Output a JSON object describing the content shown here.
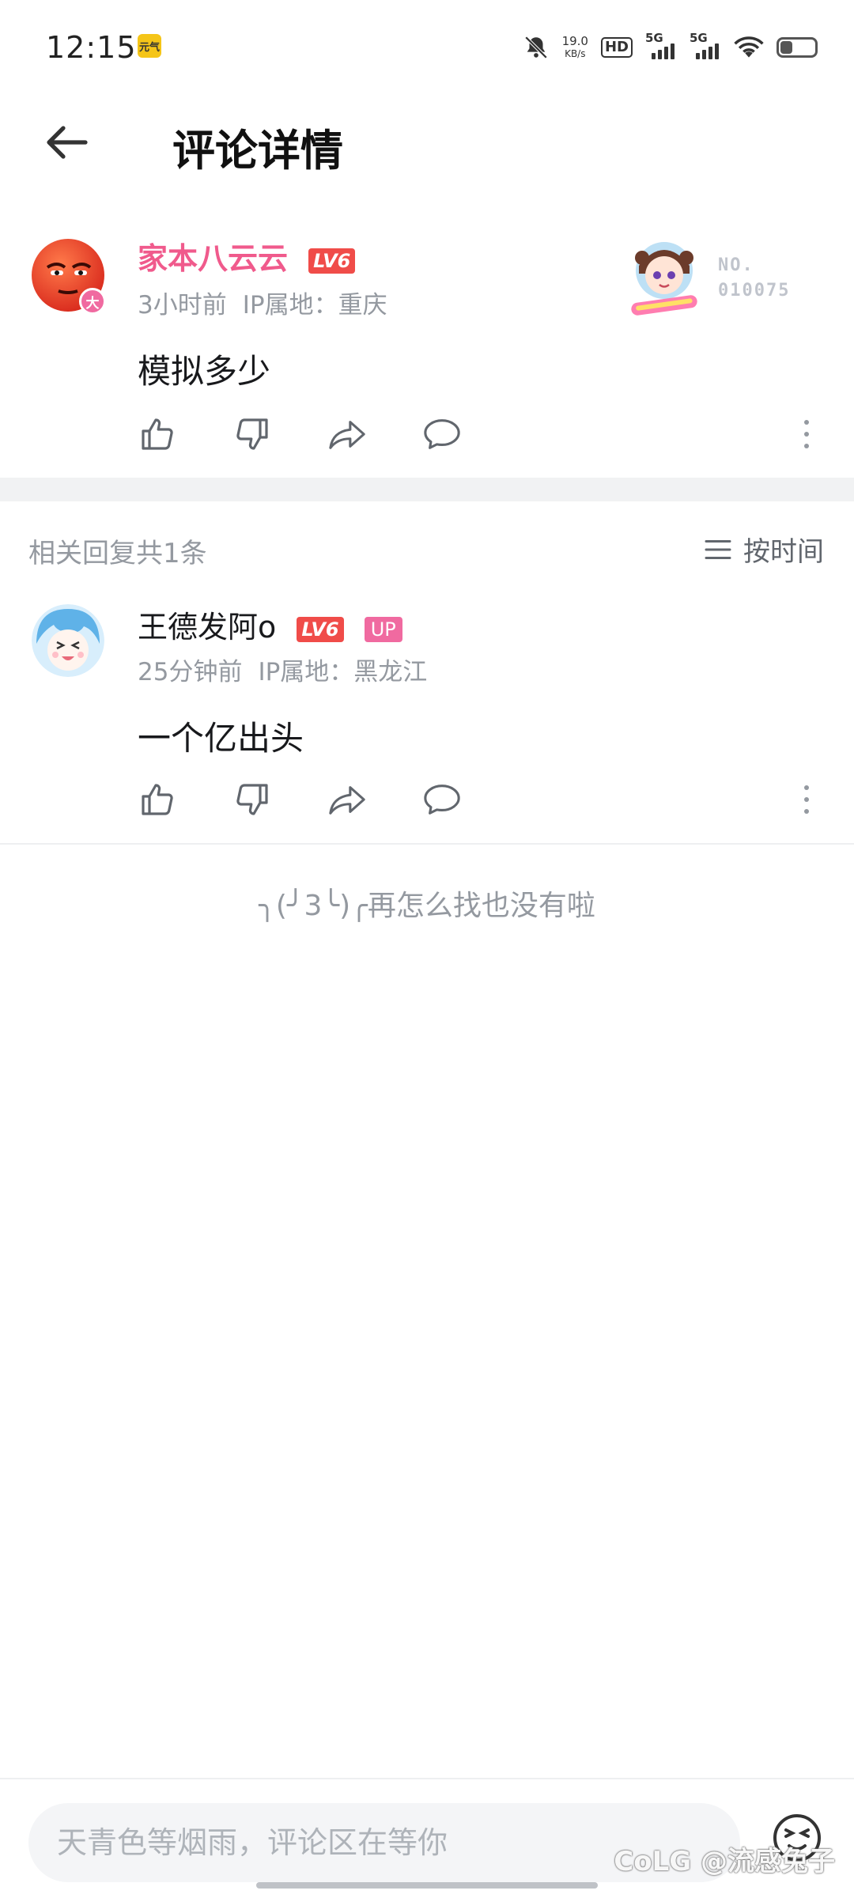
{
  "status_bar": {
    "time": "12:15",
    "app_badge": "元气",
    "net_speed_value": "19.0",
    "net_speed_unit": "KB/s",
    "hd_label": "HD",
    "sim1_label": "5G",
    "sim2_label": "5G",
    "battery_level": 0.35
  },
  "header": {
    "title": "评论详情"
  },
  "root_comment": {
    "username": "家本八云云",
    "username_color": "#f05a8c",
    "level": "LV6",
    "badge_char": "大",
    "time": "3小时前",
    "location": "IP属地：重庆",
    "content": "模拟多少",
    "fan_card_label_1": "NO.",
    "fan_card_label_2": "010075"
  },
  "replies": {
    "header": "相关回复共1条",
    "sort_label": "按时间",
    "items": [
      {
        "username": "王德发阿o",
        "level": "LV6",
        "up_badge": "UP",
        "time": "25分钟前",
        "location": "IP属地：黑龙江",
        "content": "一个亿出头"
      }
    ]
  },
  "end_message": "╮(╯3╰)╭再怎么找也没有啦",
  "bottom_bar": {
    "input_placeholder": "天青色等烟雨，评论区在等你",
    "watermark": "CoLG @流感兔子"
  },
  "colors": {
    "accent_pink": "#f06aa0",
    "level_red": "#f04c49",
    "meta_gray": "#9499a0",
    "divider": "#f1f2f3"
  }
}
